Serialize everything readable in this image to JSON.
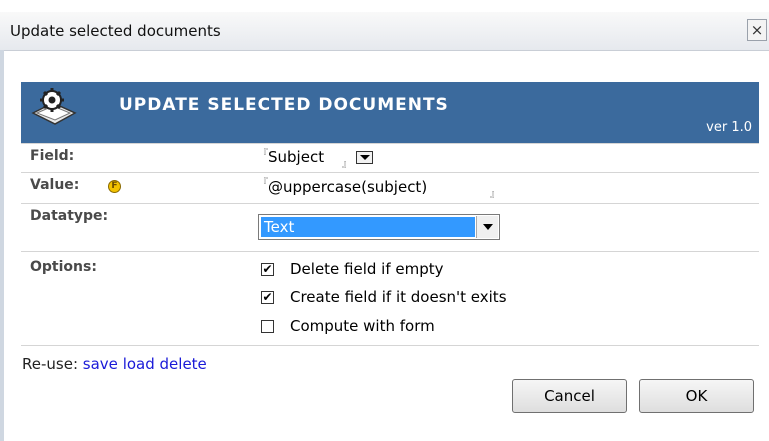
{
  "window": {
    "title": "Update selected documents",
    "close_glyph": "×"
  },
  "banner": {
    "heading": "UPDATE SELECTED DOCUMENTS",
    "version": "ver 1.0",
    "bg_color": "#3b6a9d"
  },
  "form": {
    "field": {
      "label": "Field:",
      "value": "Subject"
    },
    "value": {
      "label": "Value:",
      "icon_text": "F",
      "value": "@uppercase(subject)"
    },
    "datatype": {
      "label": "Datatype:",
      "selected": "Text"
    },
    "options": {
      "label": "Options:",
      "items": [
        {
          "label": "Delete field if empty",
          "checked": true
        },
        {
          "label": "Create field if it doesn't exits",
          "checked": true
        },
        {
          "label": "Compute with form",
          "checked": false
        }
      ]
    }
  },
  "reuse": {
    "label": "Re-use:",
    "links": [
      "save",
      "load",
      "delete"
    ]
  },
  "buttons": {
    "cancel": "Cancel",
    "ok": "OK"
  },
  "icons": {
    "banner_logo": "gear-document-icon",
    "value_formula": "formula-icon",
    "close": "close-icon"
  }
}
